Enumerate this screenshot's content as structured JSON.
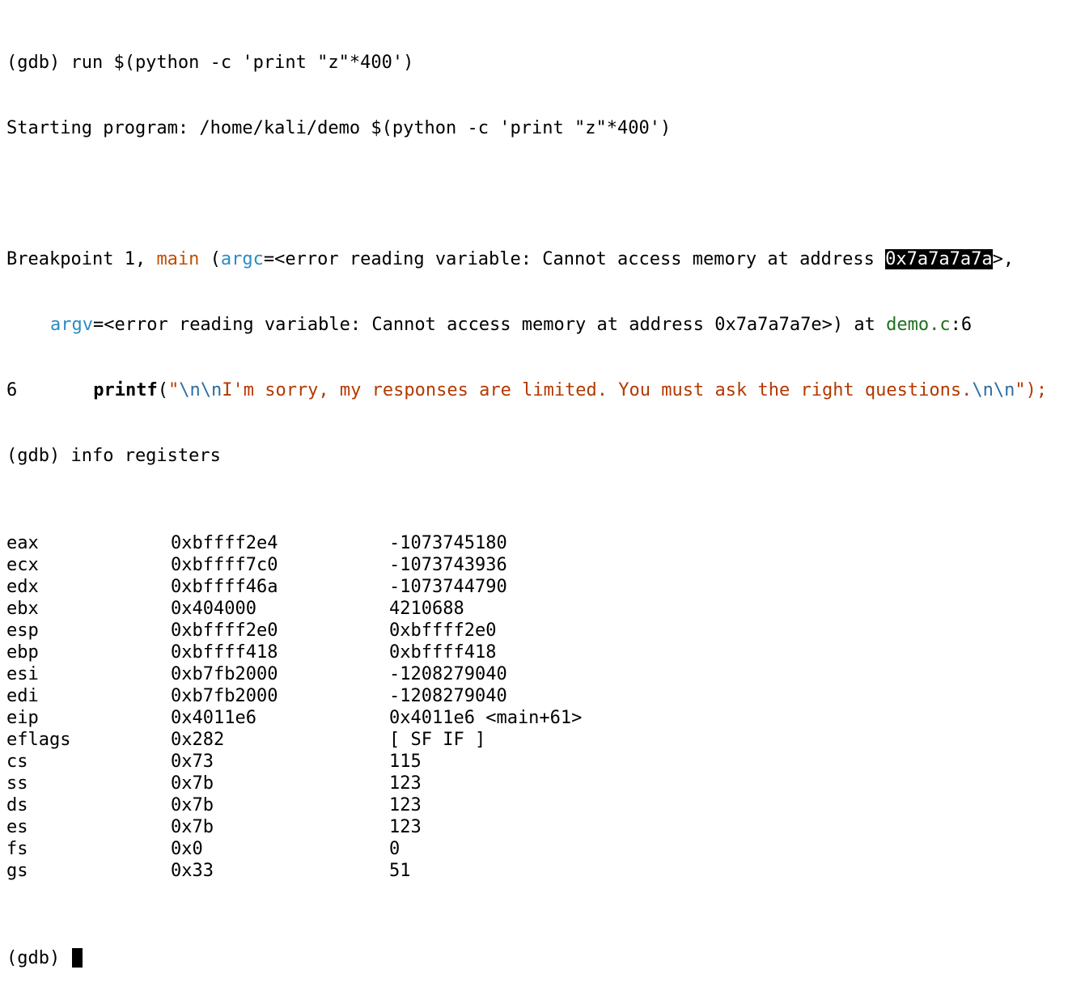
{
  "terminal": {
    "run_cmd": "(gdb) run $(python -c 'print \"z\"*400')",
    "starting": "Starting program: /home/kali/demo $(python -c 'print \"z\"*400')",
    "bp_prefix": "Breakpoint 1, ",
    "bp_fn": "main",
    "bp_open": " (",
    "bp_argc": "argc",
    "bp_argc_err": "=<error reading variable: Cannot access memory at address ",
    "bp_argc_addr": "0x7a7a7a7a",
    "bp_argc_end": ">,",
    "bp_argv": "argv",
    "bp_argv_err": "=<error reading variable: Cannot access memory at address 0x7a7a7a7e>) at ",
    "bp_file": "demo.c",
    "bp_line": ":6",
    "src_lineno": "6",
    "src_fn": "printf",
    "src_open": "(",
    "src_q1": "\"",
    "src_esc1": "\\n\\n",
    "src_text": "I'm sorry, my responses are limited. You must ask the right questions.",
    "src_esc2": "\\n\\n",
    "src_q2": "\"",
    "src_close": ");",
    "info_cmd": "(gdb) info registers",
    "prompt": "(gdb) "
  },
  "registers": [
    {
      "name": "eax",
      "hex": "0xbffff2e4",
      "value": "-1073745180"
    },
    {
      "name": "ecx",
      "hex": "0xbffff7c0",
      "value": "-1073743936"
    },
    {
      "name": "edx",
      "hex": "0xbffff46a",
      "value": "-1073744790"
    },
    {
      "name": "ebx",
      "hex": "0x404000",
      "value": "4210688"
    },
    {
      "name": "esp",
      "hex": "0xbffff2e0",
      "value": "0xbffff2e0"
    },
    {
      "name": "ebp",
      "hex": "0xbffff418",
      "value": "0xbffff418"
    },
    {
      "name": "esi",
      "hex": "0xb7fb2000",
      "value": "-1208279040"
    },
    {
      "name": "edi",
      "hex": "0xb7fb2000",
      "value": "-1208279040"
    },
    {
      "name": "eip",
      "hex": "0x4011e6",
      "value": "0x4011e6 <main+61>"
    },
    {
      "name": "eflags",
      "hex": "0x282",
      "value": "[ SF IF ]"
    },
    {
      "name": "cs",
      "hex": "0x73",
      "value": "115"
    },
    {
      "name": "ss",
      "hex": "0x7b",
      "value": "123"
    },
    {
      "name": "ds",
      "hex": "0x7b",
      "value": "123"
    },
    {
      "name": "es",
      "hex": "0x7b",
      "value": "123"
    },
    {
      "name": "fs",
      "hex": "0x0",
      "value": "0"
    },
    {
      "name": "gs",
      "hex": "0x33",
      "value": "51"
    }
  ],
  "colors": {
    "function": "#c24e00",
    "parameter": "#2b8cc4",
    "string": "#b33900",
    "escape": "#2b6ea3",
    "file": "#1f6f1f"
  }
}
